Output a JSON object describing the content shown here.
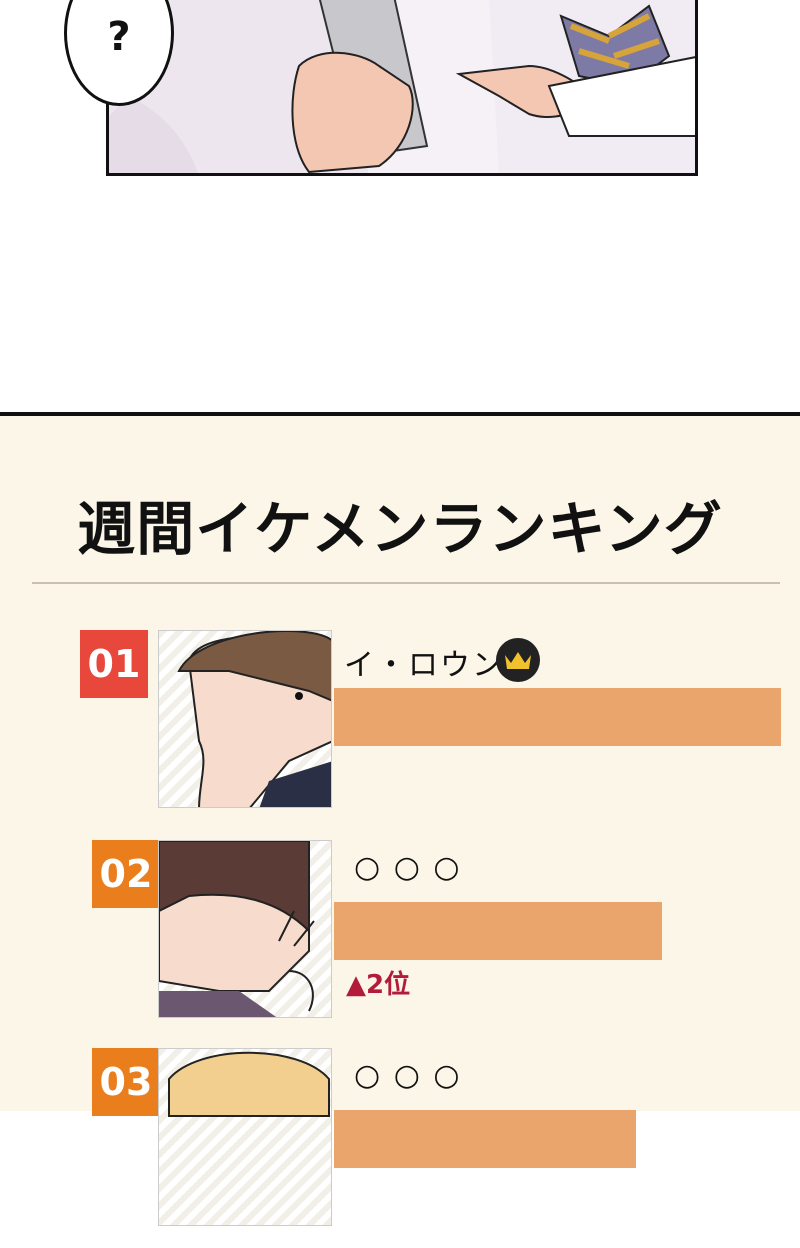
{
  "comic_panel": {
    "speech_bubble_text": "?"
  },
  "ranking": {
    "title": "週間イケメンランキング",
    "entries": [
      {
        "rank": "01",
        "name": "イ・ロウン",
        "crown_icon": "crown-icon",
        "score_fraction": 0.86,
        "rank_color": "#e8473c",
        "change": ""
      },
      {
        "rank": "02",
        "name": "○ ○ ○",
        "score_fraction": 0.63,
        "rank_color": "#eb7e1c",
        "change": "▲2位"
      },
      {
        "rank": "03",
        "name": "○ ○ ○",
        "score_fraction": 0.58,
        "rank_color": "#eb7e1c",
        "change": ""
      }
    ],
    "bar_color": "#e9a56c",
    "change_color": "#b21c3a"
  }
}
